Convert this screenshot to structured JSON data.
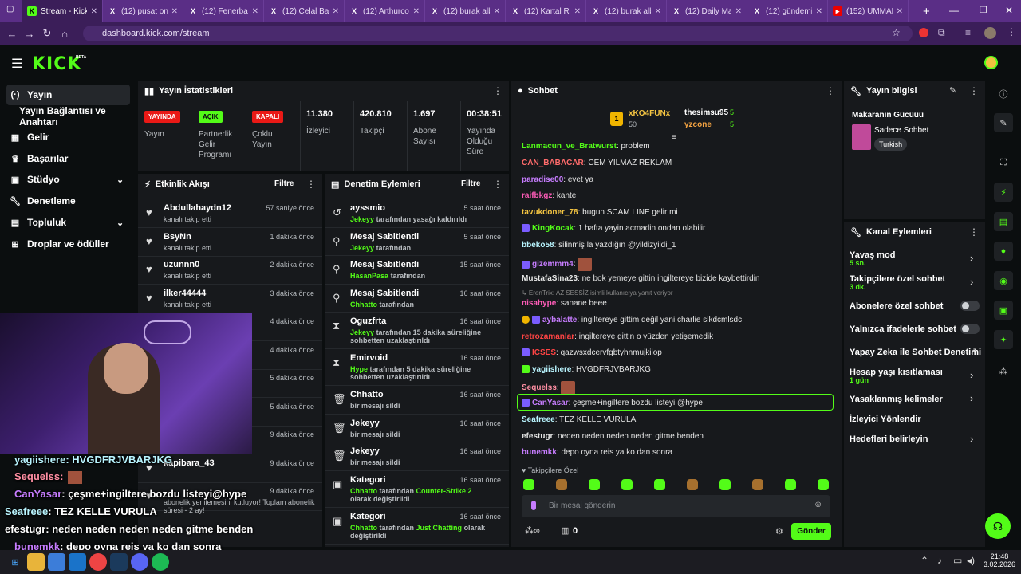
{
  "browser": {
    "tabs": [
      {
        "title": "Stream - Kick D",
        "icon": "kick-icon",
        "active": true
      },
      {
        "title": "(12) pusat on X",
        "icon": "x-icon"
      },
      {
        "title": "(12) Fenerbahç",
        "icon": "x-icon"
      },
      {
        "title": "(12) Celal Bayg",
        "icon": "x-icon"
      },
      {
        "title": "(12) Arthurco o",
        "icon": "x-icon"
      },
      {
        "title": "(12) burak alba",
        "icon": "x-icon"
      },
      {
        "title": "(12) Kartal Reci",
        "icon": "x-icon"
      },
      {
        "title": "(12) burak alba",
        "icon": "x-icon"
      },
      {
        "title": "(12) Daily Mag",
        "icon": "x-icon"
      },
      {
        "title": "(12) gündemic",
        "icon": "x-icon"
      },
      {
        "title": "(152) UMMAN",
        "icon": "youtube-icon"
      }
    ],
    "url": "dashboard.kick.com/stream"
  },
  "brand": {
    "logo": "KICK",
    "beta": "BETA",
    "accent": "#53fc18"
  },
  "sidebar": {
    "items": [
      {
        "label": "Yayın",
        "icon": "broadcast-icon"
      },
      {
        "label": "Yayın Bağlantısı ve Anahtarı",
        "icon": ""
      },
      {
        "label": "Gelir",
        "icon": "revenue-icon"
      },
      {
        "label": "Başarılar",
        "icon": "trophy-icon"
      },
      {
        "label": "Stüdyo",
        "icon": "studio-icon"
      },
      {
        "label": "Denetleme",
        "icon": "wrench-icon"
      },
      {
        "label": "Topluluk",
        "icon": "community-icon"
      },
      {
        "label": "Droplar ve ödüller",
        "icon": "drops-icon"
      }
    ]
  },
  "stats": {
    "title": "Yayın İstatistikleri",
    "items": [
      {
        "badge": "YAYINDA",
        "label": "Yayın",
        "color": "#e91916"
      },
      {
        "badge": "AÇIK",
        "label": "Partnerlik Gelir Programı",
        "color": "#53fc18"
      },
      {
        "badge": "KAPALI",
        "label": "Çoklu Yayın",
        "color": "#e91916"
      },
      {
        "value": "11.380",
        "label": "İzleyici"
      },
      {
        "value": "420.810",
        "label": "Takipçi"
      },
      {
        "value": "1.697",
        "label": "Abone Sayısı"
      },
      {
        "value": "00:38:51",
        "label": "Yayında Olduğu Süre"
      }
    ]
  },
  "activity": {
    "title": "Etkinlik Akışı",
    "filter": "Filtre",
    "rows": [
      {
        "name": "Abdullahaydn12",
        "sub": "kanalı takip etti",
        "time": "57 saniye önce"
      },
      {
        "name": "BsyNn",
        "sub": "kanalı takip etti",
        "time": "1 dakika önce"
      },
      {
        "name": "uzunnn0",
        "sub": "kanalı takip etti",
        "time": "2 dakika önce"
      },
      {
        "name": "ilker44444",
        "sub": "kanalı takip etti",
        "time": "3 dakika önce"
      },
      {
        "name": "",
        "sub": "",
        "time": "4 dakika önce"
      },
      {
        "name": "",
        "sub": "",
        "time": "4 dakika önce"
      },
      {
        "name": "",
        "sub": "",
        "time": "5 dakika önce"
      },
      {
        "name": "",
        "sub": "",
        "time": "5 dakika önce"
      },
      {
        "name": "",
        "sub": "",
        "time": "9 dakika önce"
      },
      {
        "name": "kapibara_43",
        "sub": "",
        "time": "9 dakika önce"
      },
      {
        "name": "",
        "sub": "abonelik yenilemesini kutluyor! Toplam abonelik süresi - 2 ay!",
        "time": "9 dakika önce"
      }
    ]
  },
  "moderation": {
    "title": "Denetim Eylemleri",
    "filter": "Filtre",
    "rows": [
      {
        "icon": "unban-icon",
        "name": "ayssmio",
        "mod": "Jekeyy",
        "sub": "tarafından yasağı kaldırıldı",
        "time": "5 saat önce"
      },
      {
        "icon": "pin-icon",
        "name": "Mesaj Sabitlendi",
        "mod": "Jekeyy",
        "sub": "tarafından",
        "time": "5 saat önce"
      },
      {
        "icon": "pin-icon",
        "name": "Mesaj Sabitlendi",
        "mod": "HasanPasa",
        "sub": "tarafından",
        "time": "15 saat önce"
      },
      {
        "icon": "pin-icon",
        "name": "Mesaj Sabitlendi",
        "mod": "Chhatto",
        "sub": "tarafından",
        "time": "16 saat önce"
      },
      {
        "icon": "timeout-icon",
        "name": "Oguzfrta",
        "mod": "Jekeyy",
        "sub": "tarafından 15 dakika süreliğine sohbetten uzaklaştırıldı",
        "time": "16 saat önce"
      },
      {
        "icon": "timeout-icon",
        "name": "Emirvoid",
        "mod": "Hype",
        "sub": "tarafından 5 dakika süreliğine sohbetten uzaklaştırıldı",
        "time": "16 saat önce"
      },
      {
        "icon": "trash-icon",
        "name": "Chhatto",
        "mod": "",
        "sub": "bir mesajı sildi",
        "time": "16 saat önce"
      },
      {
        "icon": "trash-icon",
        "name": "Jekeyy",
        "mod": "",
        "sub": "bir mesajı sildi",
        "time": "16 saat önce"
      },
      {
        "icon": "trash-icon",
        "name": "Jekeyy",
        "mod": "",
        "sub": "bir mesajı sildi",
        "time": "16 saat önce"
      },
      {
        "icon": "category-icon",
        "name": "Kategori",
        "mod": "Chhatto",
        "sub": "tarafından",
        "extra": "Counter-Strike 2",
        "tail": "olarak değiştirildi",
        "time": "16 saat önce"
      },
      {
        "icon": "category-icon",
        "name": "Kategori",
        "mod": "Chhatto",
        "sub": "tarafından",
        "extra": "Just Chatting",
        "tail": "olarak değiştirildi",
        "time": "16 saat önce"
      }
    ]
  },
  "chat": {
    "title": "Sohbet",
    "leaders": [
      {
        "name": "xKO4FUNx",
        "count": "50"
      },
      {
        "name": "thesimsu95",
        "count": "5"
      },
      {
        "name": "yzcone",
        "count": "5"
      }
    ],
    "messages": [
      {
        "user": "Lanmacun_ve_Bratwurst",
        "text": "problem",
        "color": "#53fc18"
      },
      {
        "user": "CAN_BABACAR",
        "text": "CEM YILMAZ REKLAM",
        "color": "#ff6b6b"
      },
      {
        "user": "paradise00",
        "text": "evet ya",
        "color": "#c77dff"
      },
      {
        "user": "raifbkgz",
        "text": "kante",
        "color": "#ff5cb8"
      },
      {
        "user": "tavukdoner_78",
        "text": "bugun SCAM LINE gelir mi",
        "color": "#f5c542"
      },
      {
        "user": "KingKocak",
        "text": "1 hafta yayin acmadin ondan olabilir",
        "color": "#53fc18"
      },
      {
        "user": "bbeko58",
        "text": "silinmiş la yazdığın @yildizyildi_1",
        "color": "#b9f5ff"
      },
      {
        "user": "gizemmm4",
        "text": "",
        "color": "#c77dff"
      },
      {
        "user": "MustafaSina23",
        "text": "ne bok yemeye gittin ingiltereye bizide kaybettirdin",
        "color": "#e6e6e6"
      },
      {
        "user": "",
        "text": "↳ ErenTrix: AZ SESSİZ isimli kullanıcıya yanıt veriyor",
        "color": "#888"
      },
      {
        "user": "nisahype",
        "text": "sanane beee",
        "color": "#ff5cb8"
      },
      {
        "user": "aybalatte",
        "text": "ingiltereye gittim değil yani charlie slkdcmlsdc",
        "color": "#c77dff"
      },
      {
        "user": "retrozamanlar",
        "text": "ingiltereye gittin o yüzden yetişemedik",
        "color": "#ff4444"
      },
      {
        "user": "ICSES",
        "text": "qazwsxdcervfgbtyhnmujkilop",
        "color": "#ff4444"
      },
      {
        "user": "yagiishere",
        "text": "HVGDFRJVBARJKG",
        "color": "#b9f5ff"
      },
      {
        "user": "Sequelss",
        "text": "",
        "color": "#ff8fa3"
      },
      {
        "user": "CanYasar",
        "text": "çeşme+ingiltere bozdu listeyi @hype",
        "color": "#c77dff"
      },
      {
        "user": "Seafreee",
        "text": "TEZ KELLE VURULA",
        "color": "#b9f5ff"
      },
      {
        "user": "efestugr",
        "text": "neden neden neden neden gitme benden",
        "color": "#e6e6e6"
      },
      {
        "user": "bunemkk",
        "text": "depo oyna reis ya ko dan sonra",
        "color": "#c77dff"
      }
    ],
    "emote_label": "Takipçilere Özel",
    "input_placeholder": "Bir mesaj gönderin",
    "points": "0",
    "send": "Gönder"
  },
  "info": {
    "title": "Yayın bilgisi",
    "stream_title": "Makaranın Gücüüü",
    "category": "Sadece Sohbet",
    "language": "Turkish"
  },
  "channel_actions": {
    "title": "Kanal Eylemleri",
    "items": [
      {
        "label": "Yavaş mod",
        "sub": "5 sn.",
        "control": "chevron"
      },
      {
        "label": "Takipçilere özel sohbet",
        "sub": "3 dk.",
        "control": "chevron"
      },
      {
        "label": "Abonelere özel sohbet",
        "sub": "",
        "control": "toggle"
      },
      {
        "label": "Yalnızca ifadelerle sohbet",
        "sub": "",
        "control": "toggle"
      },
      {
        "label": "Yapay Zeka ile Sohbet Denetimi",
        "sub": "",
        "control": "external"
      },
      {
        "label": "Hesap yaşı kısıtlaması",
        "sub": "1 gün",
        "control": "chevron"
      },
      {
        "label": "Yasaklanmış kelimeler",
        "sub": "",
        "control": "chevron"
      },
      {
        "label": "İzleyici Yönlendir",
        "sub": "",
        "control": "none"
      },
      {
        "label": "Hedefleri belirleyin",
        "sub": "",
        "control": "chevron"
      }
    ]
  },
  "overlay": {
    "lines": [
      {
        "user": "yagiishere",
        "text": ": HVGDFRJVBARJKG"
      },
      {
        "user": "Sequelss",
        "text": ":"
      },
      {
        "user": "CanYasar",
        "text": ": çeşme+ingiltere bozdu listeyi@hype"
      },
      {
        "user": "Seafreee",
        "text": ": TEZ KELLE VURULA"
      },
      {
        "user": "efestugr",
        "text": ": neden neden neden neden gitme benden"
      },
      {
        "user": "bunemkk",
        "text": ": depo oyna reis ya ko dan sonra"
      }
    ]
  },
  "taskbar": {
    "time": "21:48",
    "date": "3.02.2026"
  }
}
